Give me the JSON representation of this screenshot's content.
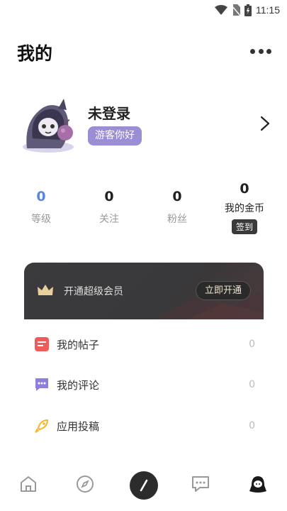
{
  "status_bar": {
    "time": "11:15",
    "icons": [
      "wifi-icon",
      "no-sim-icon",
      "battery-icon"
    ]
  },
  "header": {
    "title": "我的",
    "more_icon": "more-dots-icon"
  },
  "profile": {
    "name": "未登录",
    "badge": "游客你好",
    "avatar_icon": "avatar-illustration",
    "arrow_icon": "chevron-right-icon"
  },
  "stats": [
    {
      "value": "0",
      "label": "等级"
    },
    {
      "value": "0",
      "label": "关注"
    },
    {
      "value": "0",
      "label": "粉丝"
    },
    {
      "value": "0",
      "label": "我的金币",
      "action": "签到"
    }
  ],
  "vip": {
    "text": "开通超级会员",
    "button": "立即开通",
    "icon": "crown-icon"
  },
  "menu": [
    {
      "label": "我的帖子",
      "count": "0",
      "icon": "posts-icon"
    },
    {
      "label": "我的评论",
      "count": "0",
      "icon": "comments-icon"
    },
    {
      "label": "应用投稿",
      "count": "0",
      "icon": "rocket-icon"
    }
  ],
  "tabbar": [
    "home-icon",
    "discover-icon",
    "post-icon",
    "message-icon",
    "profile-icon"
  ],
  "colors": {
    "accent_blue": "#5b87d8",
    "badge_purple": "#9b8ed4",
    "vip_dark": "#3b3b3d",
    "vip_gold": "#f0e4c8"
  }
}
